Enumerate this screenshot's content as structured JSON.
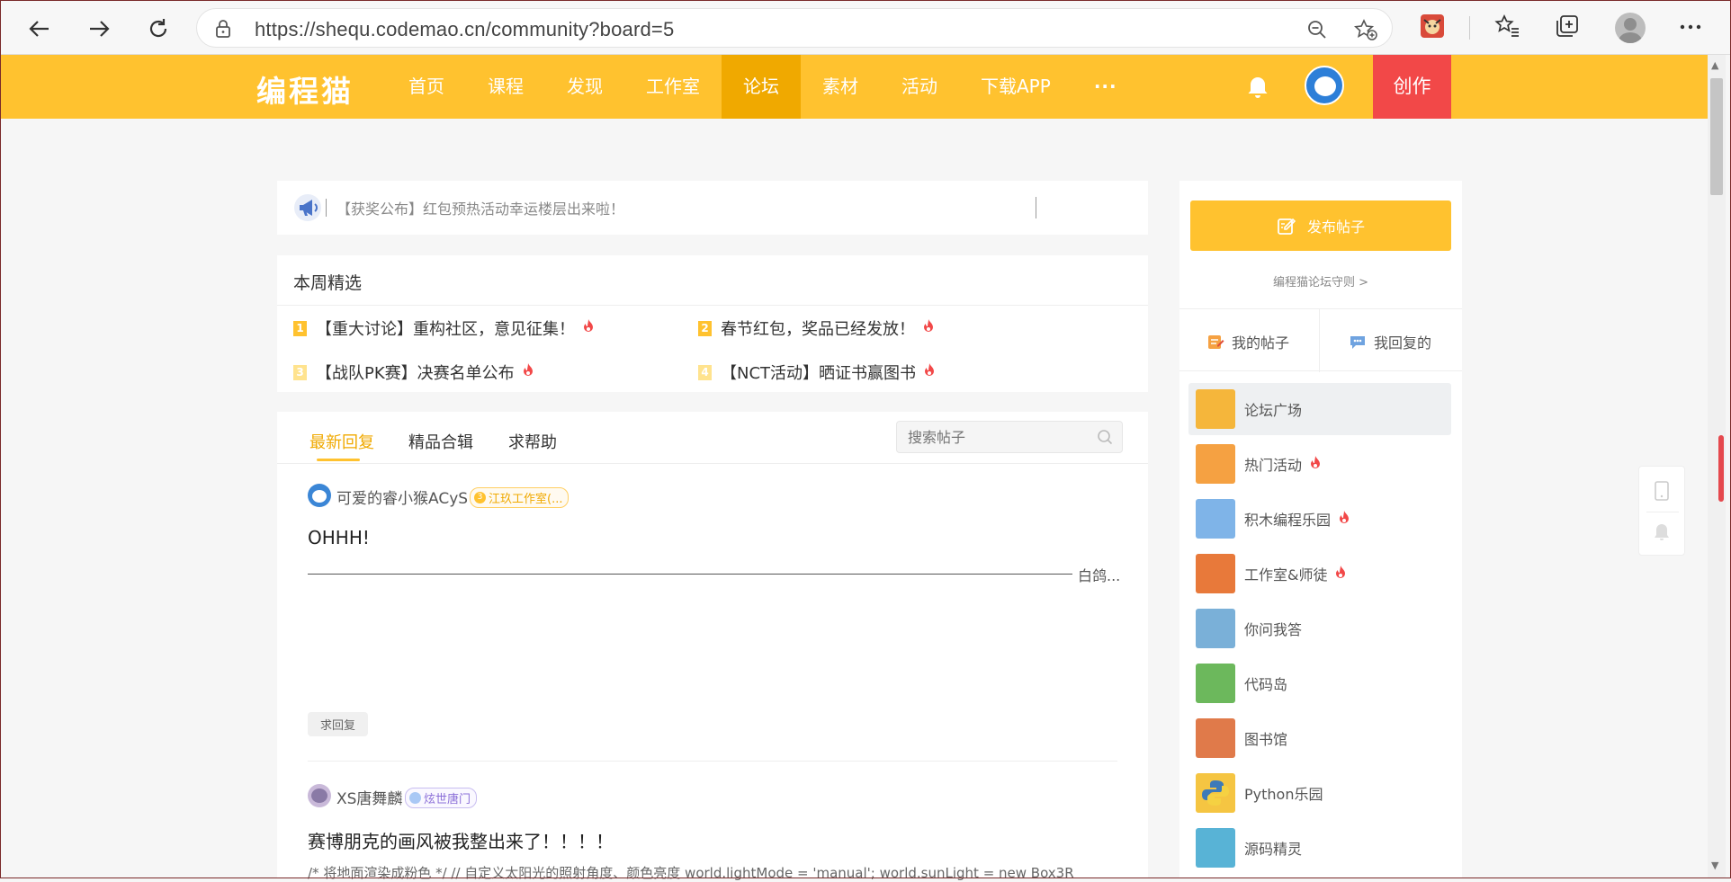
{
  "browser": {
    "url": "https://shequ.codemao.cn/community?board=5",
    "icons": [
      "back-icon",
      "forward-icon",
      "refresh-icon",
      "lock-icon",
      "zoom-out-icon",
      "add-favorite-icon",
      "extension-icon",
      "favorites-icon",
      "collections-icon",
      "profile-icon",
      "more-icon"
    ]
  },
  "header": {
    "logo": "编程猫",
    "menu": [
      {
        "label": "首页"
      },
      {
        "label": "课程"
      },
      {
        "label": "发现"
      },
      {
        "label": "工作室"
      },
      {
        "label": "论坛",
        "active": true
      },
      {
        "label": "素材"
      },
      {
        "label": "活动"
      },
      {
        "label": "下载APP"
      },
      {
        "label": "···"
      }
    ],
    "create_label": "创作",
    "brand_color": "#ffc22f"
  },
  "announcement": {
    "text": "【获奖公布】红包预热活动幸运楼层出来啦！"
  },
  "weekly": {
    "title": "本周精选",
    "items": [
      {
        "num": "1",
        "text": "【重大讨论】重构社区，意见征集！"
      },
      {
        "num": "2",
        "text": "春节红包，奖品已经发放！"
      },
      {
        "num": "3",
        "text": "【战队PK赛】决赛名单公布"
      },
      {
        "num": "4",
        "text": "【NCT活动】晒证书赢图书"
      }
    ]
  },
  "tabs": {
    "items": [
      "最新回复",
      "精品合辑",
      "求帮助"
    ],
    "search_placeholder": "搜索帖子"
  },
  "posts": [
    {
      "user": "可爱的睿小猴ACyS",
      "badge_level": "3",
      "badge": "江玖工作室(...",
      "title": "OHHH!",
      "more": "白鸽...",
      "tag": "求回复"
    },
    {
      "user": "XS唐舞麟",
      "badge_level": "",
      "badge": "炫世唐门",
      "title": "赛博朋克的画风被我整出来了！！！！",
      "snippet": "/* 将地面渲染成粉色 */   // 自定义太阳光的照射角度、颜色亮度 world.lightMode = 'manual'; world.sunLight = new Box3R"
    }
  ],
  "sidebar": {
    "publish_label": "发布帖子",
    "rules_label": "编程猫论坛守则 >",
    "my_posts": "我的帖子",
    "my_replies": "我回复的",
    "boards": [
      {
        "label": "论坛广场",
        "active": true,
        "hot": false,
        "color": "#f5b63b"
      },
      {
        "label": "热门活动",
        "hot": true,
        "color": "#f5a142"
      },
      {
        "label": "积木编程乐园",
        "hot": true,
        "color": "#7fb4e8"
      },
      {
        "label": "工作室&师徒",
        "hot": true,
        "color": "#e8793a"
      },
      {
        "label": "你问我答",
        "hot": false,
        "color": "#7ab0d8"
      },
      {
        "label": "代码岛",
        "hot": false,
        "color": "#6cb85c"
      },
      {
        "label": "图书馆",
        "hot": false,
        "color": "#e07a4a"
      },
      {
        "label": "Python乐园",
        "hot": false,
        "color": "#f5c542"
      },
      {
        "label": "源码精灵",
        "hot": false,
        "color": "#58b3d6"
      }
    ]
  }
}
